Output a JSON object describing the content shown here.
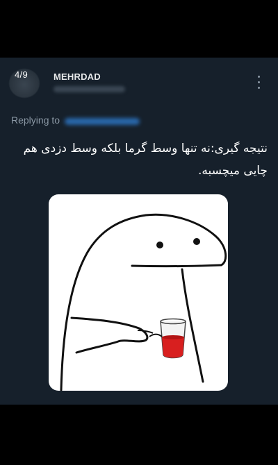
{
  "tweet": {
    "thread_counter": "4/9",
    "author_name": "MEHRDAD",
    "replying_to_label": "Replying to",
    "text": "نتیجه گیری:نه تنها وسط گرما بلکه وسط دزدی هم چایی میچسبه.",
    "media_description": "meme-drawing-figure-holding-tea-glass"
  },
  "colors": {
    "card_background": "#16202b",
    "text_primary": "#ffffff",
    "text_secondary": "#8b98a5",
    "tea": "#d81f1f"
  }
}
